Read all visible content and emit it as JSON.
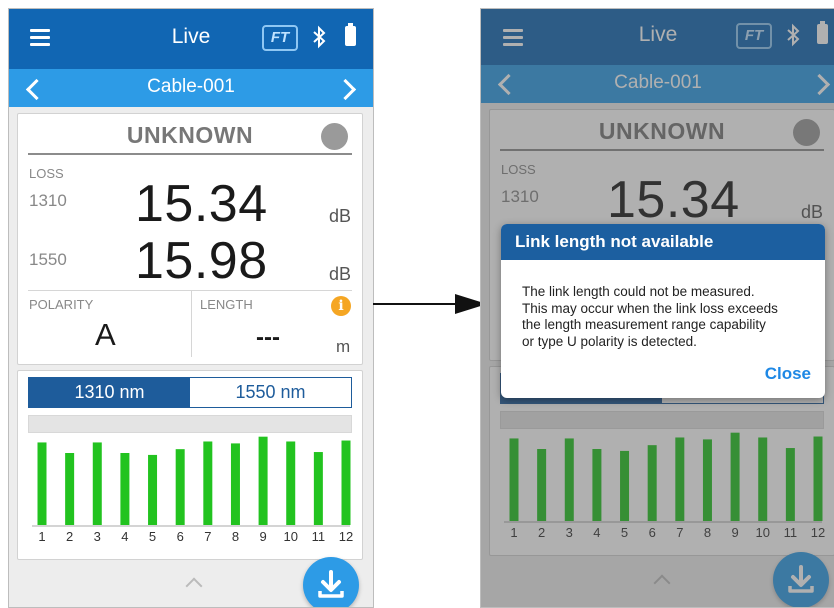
{
  "app": {
    "screen_title": "Live",
    "ft_badge": "FT",
    "cable_name": "Cable-001"
  },
  "status": {
    "label": "UNKNOWN",
    "indicator_color": "#9a9a9a"
  },
  "loss": {
    "label": "LOSS",
    "rows": [
      {
        "wavelength": "1310",
        "value": "15.34",
        "unit": "dB"
      },
      {
        "wavelength": "1550",
        "value": "15.98",
        "unit": "dB"
      }
    ]
  },
  "polarity": {
    "label": "POLARITY",
    "value": "A"
  },
  "length": {
    "label": "LENGTH",
    "value": "---",
    "unit": "m",
    "info_icon": "i"
  },
  "tabs": [
    {
      "label": "1310 nm",
      "active": true
    },
    {
      "label": "1550 nm",
      "active": false
    }
  ],
  "colors": {
    "topbar": "#1166b3",
    "subbar": "#2d9be6",
    "bar_green": "#22c31f",
    "info_orange": "#f5a623",
    "accent_blue": "#1e5c9b"
  },
  "chart_data": {
    "type": "bar",
    "categories": [
      "1",
      "2",
      "3",
      "4",
      "5",
      "6",
      "7",
      "8",
      "9",
      "10",
      "11",
      "12"
    ],
    "values": [
      0.86,
      0.75,
      0.86,
      0.75,
      0.73,
      0.79,
      0.87,
      0.85,
      0.92,
      0.87,
      0.76,
      0.88
    ],
    "ylim": [
      0,
      1
    ],
    "xlabel": "",
    "ylabel": ""
  },
  "dialog": {
    "title": "Link length not available",
    "lines": [
      "The link length could not be measured.",
      "This may occur when the link loss exceeds",
      "the length measurement range capability",
      "or type U polarity is detected."
    ],
    "close_label": "Close"
  }
}
